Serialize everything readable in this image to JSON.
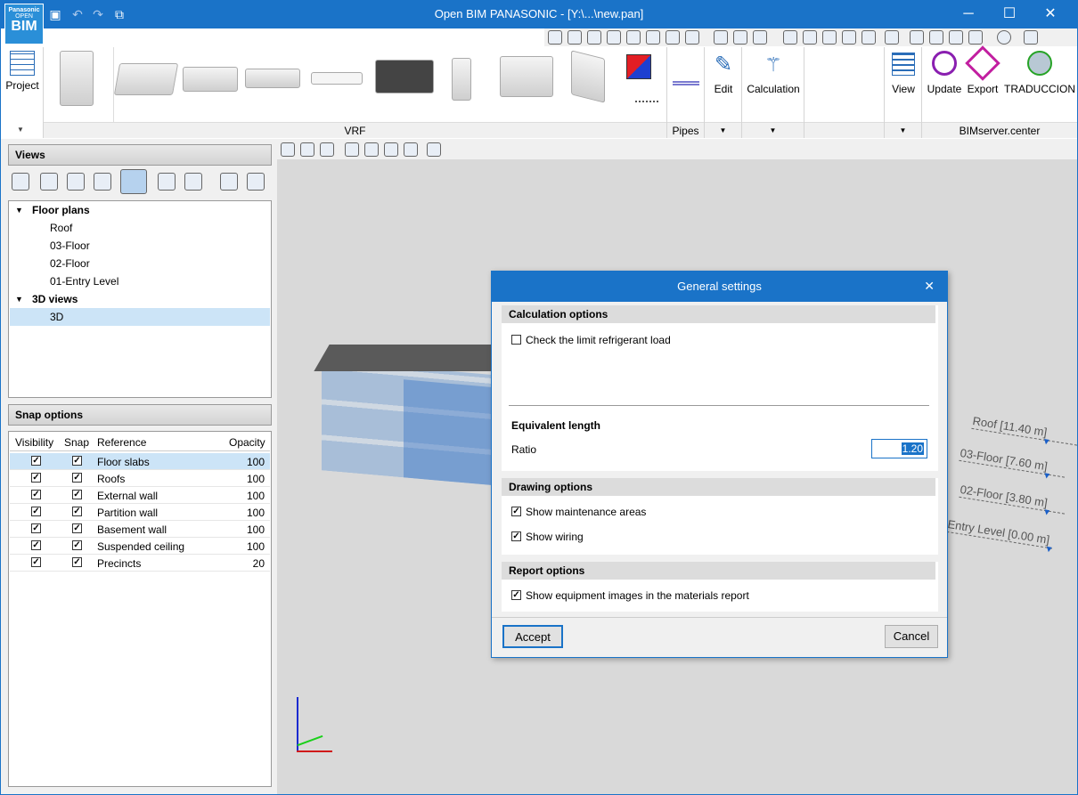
{
  "app": {
    "title": "Open BIM PANASONIC - [Y:\\...\\new.pan]",
    "logo_top": "Panasonic",
    "logo_mid": "OPEN",
    "logo_bot": "BIM"
  },
  "window": {
    "minimize": "─",
    "maximize": "☐",
    "close": "✕"
  },
  "ribbon": {
    "project_label": "Project",
    "vrf_group": "VRF",
    "pipes_group": "Pipes",
    "edit_label": "Edit",
    "calculation_label": "Calculation",
    "view_label": "View",
    "update_label": "Update",
    "export_label": "Export",
    "traduccion_label": "TRADUCCION",
    "bimserver_group": "BIMserver.center"
  },
  "views_panel": {
    "title": "Views",
    "tree": [
      {
        "label": "Floor plans",
        "type": "group"
      },
      {
        "label": "Roof",
        "type": "item"
      },
      {
        "label": "03-Floor",
        "type": "item"
      },
      {
        "label": "02-Floor",
        "type": "item"
      },
      {
        "label": "01-Entry Level",
        "type": "item"
      },
      {
        "label": "3D views",
        "type": "group"
      },
      {
        "label": "3D",
        "type": "item"
      }
    ]
  },
  "snap_panel": {
    "title": "Snap options",
    "columns": [
      "Visibility",
      "Snap",
      "Reference",
      "Opacity"
    ],
    "rows": [
      {
        "reference": "Floor slabs",
        "opacity": "100"
      },
      {
        "reference": "Roofs",
        "opacity": "100"
      },
      {
        "reference": "External wall",
        "opacity": "100"
      },
      {
        "reference": "Partition wall",
        "opacity": "100"
      },
      {
        "reference": "Basement wall",
        "opacity": "100"
      },
      {
        "reference": "Suspended ceiling",
        "opacity": "100"
      },
      {
        "reference": "Precincts",
        "opacity": "20"
      }
    ]
  },
  "viewport": {
    "levels": [
      "Roof [11.40 m]",
      "03-Floor [7.60 m]",
      "02-Floor [3.80 m]",
      "Entry Level [0.00 m]"
    ]
  },
  "dialog": {
    "title": "General settings",
    "calc_header": "Calculation options",
    "limit_label": "Check the limit refrigerant load",
    "eq_length": "Equivalent length",
    "ratio_label": "Ratio",
    "ratio_value": "1.20",
    "drawing_header": "Drawing options",
    "maint_label": "Show maintenance areas",
    "wiring_label": "Show wiring",
    "report_header": "Report options",
    "images_label": "Show equipment images in the materials report",
    "accept": "Accept",
    "cancel": "Cancel",
    "close": "✕"
  }
}
